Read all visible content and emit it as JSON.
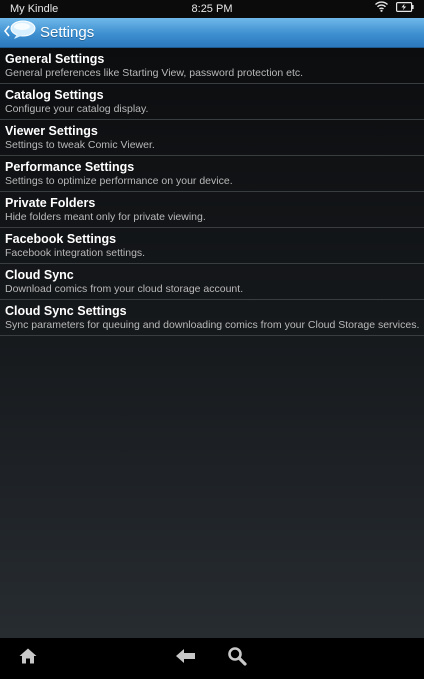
{
  "status_bar": {
    "device_name": "My Kindle",
    "time": "8:25 PM",
    "icons": [
      "wifi-icon",
      "battery-charging-icon"
    ]
  },
  "title_bar": {
    "title": "Settings",
    "back_icon": "back-chevron-icon",
    "app_icon": "speech-bubble-icon"
  },
  "settings": [
    {
      "title": "General Settings",
      "subtitle": "General preferences like Starting View, password protection etc."
    },
    {
      "title": "Catalog Settings",
      "subtitle": "Configure your catalog display."
    },
    {
      "title": "Viewer Settings",
      "subtitle": "Settings to tweak Comic Viewer."
    },
    {
      "title": "Performance Settings",
      "subtitle": "Settings to optimize performance on your device."
    },
    {
      "title": "Private Folders",
      "subtitle": "Hide folders meant only for private viewing."
    },
    {
      "title": "Facebook Settings",
      "subtitle": "Facebook integration settings."
    },
    {
      "title": "Cloud Sync",
      "subtitle": "Download comics from your cloud storage account."
    },
    {
      "title": "Cloud Sync Settings",
      "subtitle": "Sync parameters for queuing and downloading comics from your Cloud Storage services."
    }
  ],
  "nav_bar": {
    "icons": [
      "home-icon",
      "back-arrow-icon",
      "search-icon"
    ]
  },
  "colors": {
    "title_bar_accent": "#3d8fd0",
    "background": "#0c0d0f",
    "divider": "#3a3d40"
  }
}
